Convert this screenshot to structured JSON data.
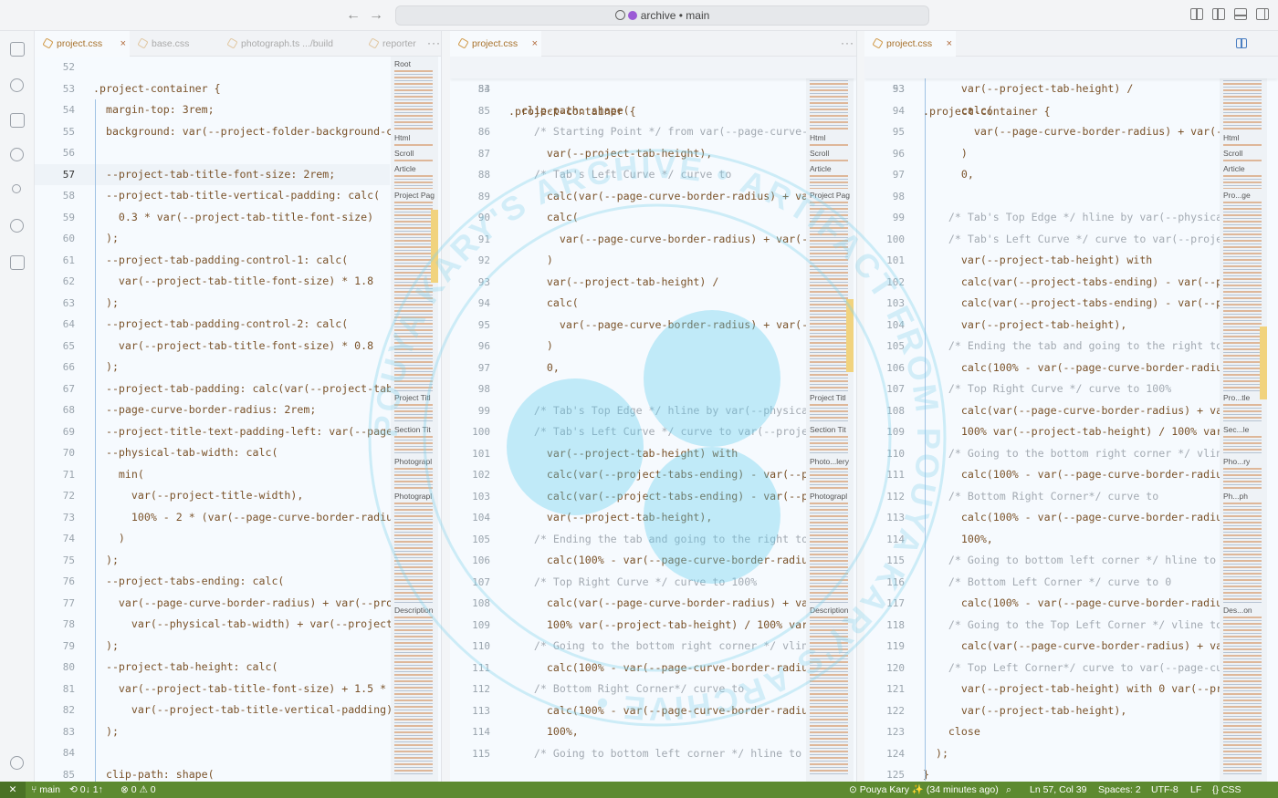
{
  "titlebar": {
    "back_glyph": "←",
    "forward_glyph": "→",
    "command_center": "archive • main"
  },
  "activity_icons": [
    "explorer-icon",
    "copilot-icon",
    "layout-icon",
    "search-icon",
    "source-control-icon",
    "run-debug-icon",
    "extensions-icon"
  ],
  "pane1": {
    "tabs": [
      {
        "label": "project.css",
        "close": "×"
      },
      {
        "label": "base.css"
      },
      {
        "label": "photograph.ts  .../build"
      },
      {
        "label": "reporter"
      }
    ],
    "more": "···",
    "lines": [
      {
        "n": "52",
        "t": ""
      },
      {
        "n": "53",
        "t": ".project-container {"
      },
      {
        "n": "54",
        "t": "  margin-top: 3rem;"
      },
      {
        "n": "55",
        "t": "  background: var(--project-folder-background-c"
      },
      {
        "n": "56",
        "t": ""
      },
      {
        "n": "57",
        "t": "  --project-tab-title-font-size: 2rem;"
      },
      {
        "n": "58",
        "t": "  --project-tab-title-vertical-padding: calc("
      },
      {
        "n": "59",
        "t": "    0.3 * var(--project-tab-title-font-size)"
      },
      {
        "n": "60",
        "t": "  );"
      },
      {
        "n": "61",
        "t": "  --project-tab-padding-control-1: calc("
      },
      {
        "n": "62",
        "t": "    var(--project-tab-title-font-size) * 1.8"
      },
      {
        "n": "63",
        "t": "  );"
      },
      {
        "n": "64",
        "t": "  --project-tab-padding-control-2: calc("
      },
      {
        "n": "65",
        "t": "    var(--project-tab-title-font-size) * 0.8"
      },
      {
        "n": "66",
        "t": "  );"
      },
      {
        "n": "67",
        "t": "  --project-tab-padding: calc(var(--project-tab"
      },
      {
        "n": "68",
        "t": "  --page-curve-border-radius: 2rem;"
      },
      {
        "n": "69",
        "t": "  --project-title-text-padding-left: var(--page"
      },
      {
        "n": "70",
        "t": "  --physical-tab-width: calc("
      },
      {
        "n": "71",
        "t": "    min("
      },
      {
        "n": "72",
        "t": "      var(--project-title-width),"
      },
      {
        "n": "73",
        "t": "      100% - 2 * (var(--page-curve-border-radiu"
      },
      {
        "n": "74",
        "t": "    )"
      },
      {
        "n": "75",
        "t": "  );"
      },
      {
        "n": "76",
        "t": "  --project-tabs-ending: calc("
      },
      {
        "n": "77",
        "t": "    var(--page-curve-border-radius) + var(--pro"
      },
      {
        "n": "78",
        "t": "      var(--physical-tab-width) + var(--project-"
      },
      {
        "n": "79",
        "t": "  );"
      },
      {
        "n": "80",
        "t": "  --project-tab-height: calc("
      },
      {
        "n": "81",
        "t": "    var(--project-tab-title-font-size) + 1.5 *"
      },
      {
        "n": "82",
        "t": "      var(--project-tab-title-vertical-padding)"
      },
      {
        "n": "83",
        "t": "  );"
      },
      {
        "n": "84",
        "t": ""
      },
      {
        "n": "85",
        "t": "  clip-path: shape("
      }
    ],
    "minimap": [
      "Root",
      "Html",
      "Scroll",
      "Article",
      "Project Pag",
      "Project Titl",
      "Section Tit",
      "Photograpl",
      "Photograpl",
      "Description"
    ]
  },
  "pane2": {
    "tabs": [
      {
        "label": "project.css",
        "close": "×"
      }
    ],
    "more": "···",
    "sticky": {
      "n": "53",
      "t": ".project-container {"
    },
    "lines": [
      {
        "n": "84",
        "t": ""
      },
      {
        "n": "85",
        "t": "  clip-path: shape("
      },
      {
        "n": "86",
        "t": "    /* Starting Point */ from var(--page-curve-b"
      },
      {
        "n": "87",
        "t": "      var(--project-tab-height),"
      },
      {
        "n": "88",
        "t": "    /* Tab's Left Curve */ curve to"
      },
      {
        "n": "89",
        "t": "      calc(var(--page-curve-border-radius) + var"
      },
      {
        "n": "90",
        "t": "      calc("
      },
      {
        "n": "91",
        "t": "        var(--page-curve-border-radius) + var(--"
      },
      {
        "n": "92",
        "t": "      )"
      },
      {
        "n": "93",
        "t": "      var(--project-tab-height) /"
      },
      {
        "n": "94",
        "t": "      calc("
      },
      {
        "n": "95",
        "t": "        var(--page-curve-border-radius) + var(--"
      },
      {
        "n": "96",
        "t": "      )"
      },
      {
        "n": "97",
        "t": "      0,"
      },
      {
        "n": "98",
        "t": ""
      },
      {
        "n": "99",
        "t": "    /* Tab's Top Edge */ hline by var(--physical"
      },
      {
        "n": "100",
        "t": "    /* Tab's Left Curve */ curve to var(--projec"
      },
      {
        "n": "101",
        "t": "      var(--project-tab-height) with"
      },
      {
        "n": "102",
        "t": "      calc(var(--project-tabs-ending) - var(--pr"
      },
      {
        "n": "103",
        "t": "      calc(var(--project-tabs-ending) - var(--pr"
      },
      {
        "n": "104",
        "t": "      var(--project-tab-height),"
      },
      {
        "n": "105",
        "t": "    /* Ending the tab and going to the right top"
      },
      {
        "n": "106",
        "t": "      calc(100% - var(--page-curve-border-radius"
      },
      {
        "n": "107",
        "t": "    /* Top Right Curve */ curve to 100%"
      },
      {
        "n": "108",
        "t": "      calc(var(--page-curve-border-radius) + var"
      },
      {
        "n": "109",
        "t": "      100% var(--project-tab-height) / 100% var("
      },
      {
        "n": "110",
        "t": "    /* Going to the bottom right corner */ vline"
      },
      {
        "n": "111",
        "t": "      calc(100% - var(--page-curve-border-radius"
      },
      {
        "n": "112",
        "t": "    /* Bottom Right Corner*/ curve to"
      },
      {
        "n": "113",
        "t": "      calc(100% - var(--page-curve-border-radius"
      },
      {
        "n": "114",
        "t": "      100%,"
      },
      {
        "n": "115",
        "t": "    /* Going to bottom left corner */ hline to v"
      }
    ],
    "minimap": [
      "Root",
      "Html",
      "Scroll",
      "Article",
      "Project Pag",
      "Project Titl",
      "Section Tit",
      "Photo...lery",
      "Photograpl",
      "Description"
    ]
  },
  "pane3": {
    "tabs": [
      {
        "label": "project.css",
        "close": "×"
      }
    ],
    "sticky": {
      "n": "53",
      "t": ".project-container {"
    },
    "lines": [
      {
        "n": "93",
        "t": "      var(--project-tab-height) /"
      },
      {
        "n": "94",
        "t": "      calc("
      },
      {
        "n": "95",
        "t": "        var(--page-curve-border-radius) + var(--"
      },
      {
        "n": "96",
        "t": "      )"
      },
      {
        "n": "97",
        "t": "      0,"
      },
      {
        "n": "98",
        "t": ""
      },
      {
        "n": "99",
        "t": "    /* Tab's Top Edge */ hline by var(--physica"
      },
      {
        "n": "100",
        "t": "    /* Tab's Left Curve */ curve to var(--proje"
      },
      {
        "n": "101",
        "t": "      var(--project-tab-height) with"
      },
      {
        "n": "102",
        "t": "      calc(var(--project-tabs-ending) - var(--p"
      },
      {
        "n": "103",
        "t": "      calc(var(--project-tabs-ending) - var(--p"
      },
      {
        "n": "104",
        "t": "      var(--project-tab-height),"
      },
      {
        "n": "105",
        "t": "    /* Ending the tab and going to the right top"
      },
      {
        "n": "106",
        "t": "      calc(100% - var(--page-curve-border-radiu"
      },
      {
        "n": "107",
        "t": "    /* Top Right Curve */ curve to 100%"
      },
      {
        "n": "108",
        "t": "      calc(var(--page-curve-border-radius) + va"
      },
      {
        "n": "109",
        "t": "      100% var(--project-tab-height) / 100% var"
      },
      {
        "n": "110",
        "t": "    /* Going to the bottom right corner */ vlin"
      },
      {
        "n": "111",
        "t": "      calc(100% - var(--page-curve-border-radiu"
      },
      {
        "n": "112",
        "t": "    /* Bottom Right Corner*/ curve to"
      },
      {
        "n": "113",
        "t": "      calc(100% - var(--page-curve-border-radiu"
      },
      {
        "n": "114",
        "t": "      100%,"
      },
      {
        "n": "115",
        "t": "    /* Going to bottom left corner */ hline to"
      },
      {
        "n": "116",
        "t": "    /* Bottom Left Corner */ curve to 0"
      },
      {
        "n": "117",
        "t": "      calc(100% - var(--page-curve-border-radiu"
      },
      {
        "n": "118",
        "t": "    /* Going to the Top Left Corner */ vline to"
      },
      {
        "n": "119",
        "t": "      calc(var(--page-curve-border-radius) + va"
      },
      {
        "n": "120",
        "t": "    /* Top Left Corner*/ curve to var(--page-cu"
      },
      {
        "n": "121",
        "t": "      var(--project-tab-height) with 0 var(--pr"
      },
      {
        "n": "122",
        "t": "      var(--project-tab-height),"
      },
      {
        "n": "123",
        "t": "    close"
      },
      {
        "n": "124",
        "t": "  );"
      },
      {
        "n": "125",
        "t": "}"
      }
    ],
    "minimap": [
      "Root",
      "Html",
      "Scroll",
      "Article",
      "Pro...ge",
      "Pro...tle",
      "Sec...le",
      "Pho...ry",
      "Ph...ph",
      "Des...on"
    ]
  },
  "statusbar": {
    "remote": "✕",
    "branch": "main",
    "sync": "⟲ 0↓ 1↑",
    "problems": "⊗ 0 ⚠ 0",
    "blame": "Pouya Kary ✨ (34 minutes ago)",
    "cursor": "Ln 57, Col 39",
    "spaces": "Spaces: 2",
    "encoding": "UTF-8",
    "eol": "LF",
    "language": "CSS",
    "language_glyph": "{}"
  },
  "watermark": {
    "text": "POUYA KARY'S ARCHIVE • ARTIFACT FROM POUYA KARY'S ARCHIVE •"
  },
  "colors": {
    "accent": "#a8722c",
    "status": "#5d8a30",
    "guide": "#a0c2e4"
  }
}
